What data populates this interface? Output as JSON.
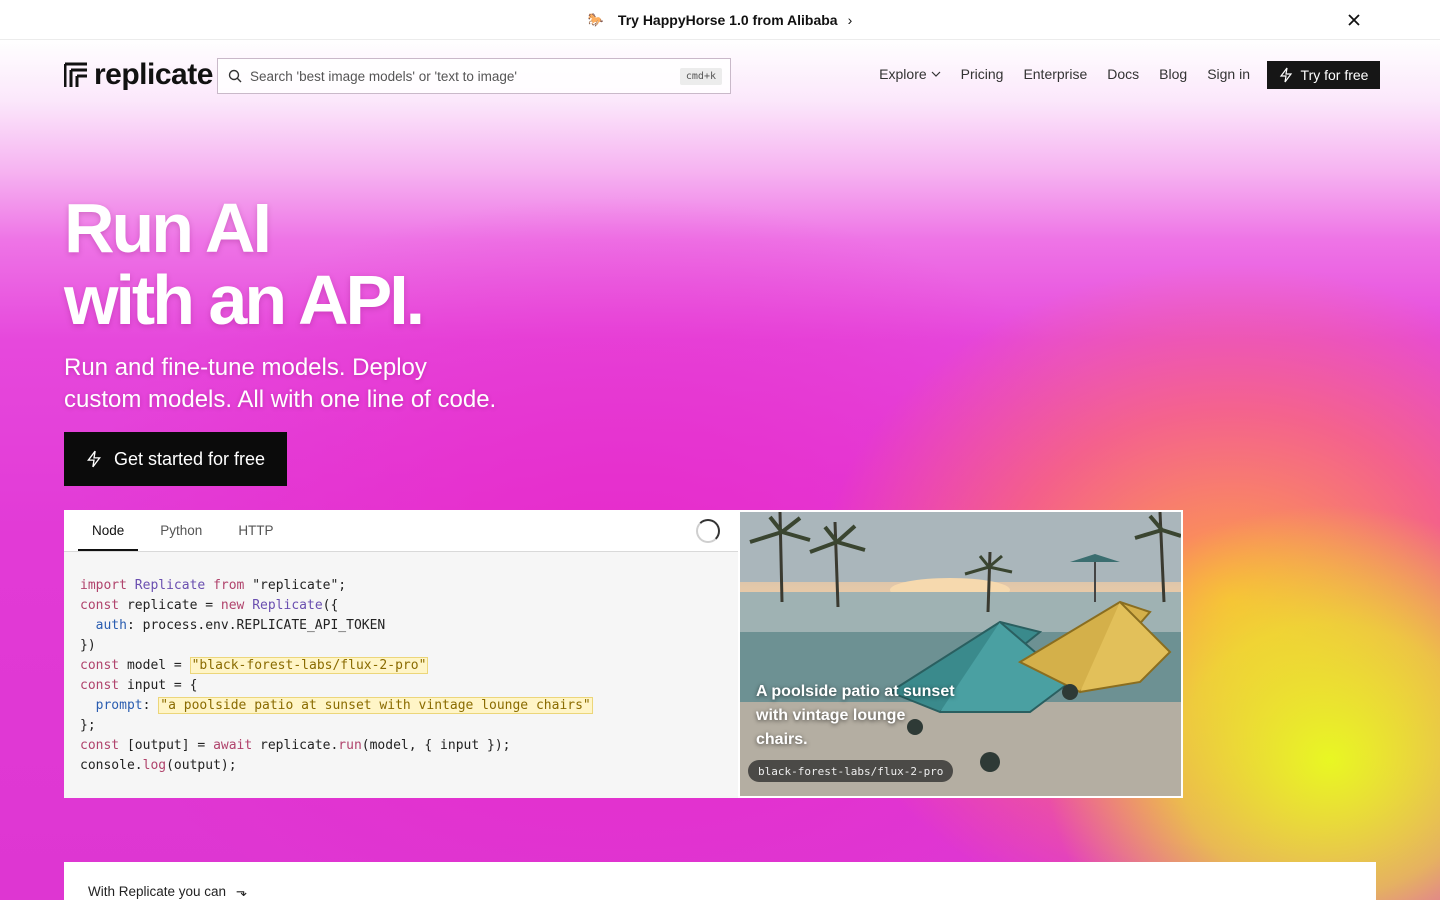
{
  "announcement": {
    "text": "Try HappyHorse 1.0 from Alibaba",
    "arrow": "›"
  },
  "nav": {
    "logo_text": "replicate",
    "search_placeholder": "Search 'best image models' or 'text to image'",
    "search_shortcut": "cmd+k",
    "links": {
      "explore": "Explore",
      "pricing": "Pricing",
      "enterprise": "Enterprise",
      "docs": "Docs",
      "blog": "Blog",
      "signin": "Sign in"
    },
    "try_button": "Try for free"
  },
  "hero": {
    "headline_line1": "Run AI",
    "headline_line2": "with an API.",
    "subhead_line1": "Run and fine-tune models. Deploy",
    "subhead_line2": "custom models. All with one line of code.",
    "cta": "Get started for free"
  },
  "code": {
    "tabs": [
      "Node",
      "Python",
      "HTTP"
    ],
    "active_tab": "Node"
  },
  "example": {
    "caption": "A poolside patio at sunset with vintage lounge chairs.",
    "model": "black-forest-labs/flux-2-pro"
  },
  "bottom": {
    "lead": "With Replicate you can"
  },
  "colors": {
    "accent_dark": "#0b0b0b",
    "hero_pink": "#e23ad6",
    "hero_yellow": "#e8ff1e"
  }
}
